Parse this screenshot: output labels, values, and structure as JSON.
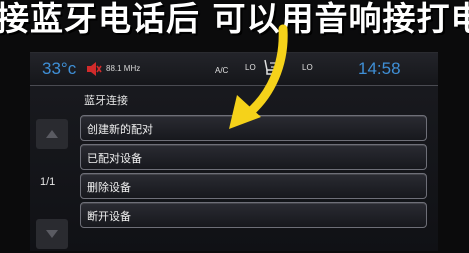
{
  "caption": {
    "text": "接蓝牙电话后 可以用音响接打电"
  },
  "status_bar": {
    "temperature_left": "33°c",
    "radio_frequency": "88.1 MHz",
    "ac_label": "A/C",
    "fan_left": "LO",
    "fan_right": "LO",
    "clock": "14:58"
  },
  "screen": {
    "title": "蓝牙连接",
    "page_indicator": "1/1",
    "menu_items": [
      {
        "label": "创建新的配对"
      },
      {
        "label": "已配对设备"
      },
      {
        "label": "删除设备"
      },
      {
        "label": "断开设备"
      }
    ]
  },
  "colors": {
    "accent_blue": "#3f8fd6",
    "arrow_yellow": "#f5d21a",
    "mute_red": "#d12b2b"
  }
}
